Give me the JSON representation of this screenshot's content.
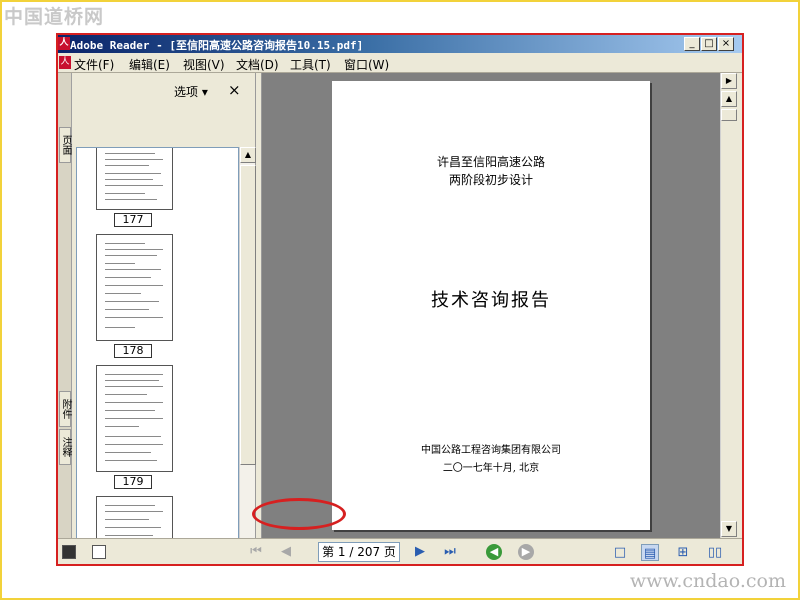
{
  "watermark_top": "中国道桥网",
  "watermark_bottom": "www.cndao.com",
  "window": {
    "app_icon": "adobe-reader-icon",
    "title": "Adobe Reader - [至信阳高速公路咨询报告10.15.pdf]",
    "controls": [
      "minimize-icon",
      "maximize-icon",
      "close-icon"
    ]
  },
  "menu": {
    "items": [
      "文件(F)",
      "编辑(E)",
      "视图(V)",
      "文档(D)",
      "工具(T)",
      "窗口(W)"
    ]
  },
  "nav_panel": {
    "tabs": [
      "页面",
      "附件",
      "注释"
    ],
    "options_label": "选项 ▾",
    "close_label": "×",
    "thumbnails": [
      "177",
      "178",
      "179"
    ]
  },
  "document": {
    "subtitle_1": "许昌至信阳高速公路",
    "subtitle_2": "两阶段初步设计",
    "title": "技术咨询报告",
    "org": "中国公路工程咨询集团有限公司",
    "date": "二〇一七年十月, 北京"
  },
  "status_bar": {
    "page_indicator": "第 1 / 207 页",
    "current_page": 1,
    "total_pages": 207
  },
  "colors": {
    "highlight_red": "#d62020",
    "frame_yellow": "#f2d23a",
    "titlebar_start": "#0a246a"
  }
}
